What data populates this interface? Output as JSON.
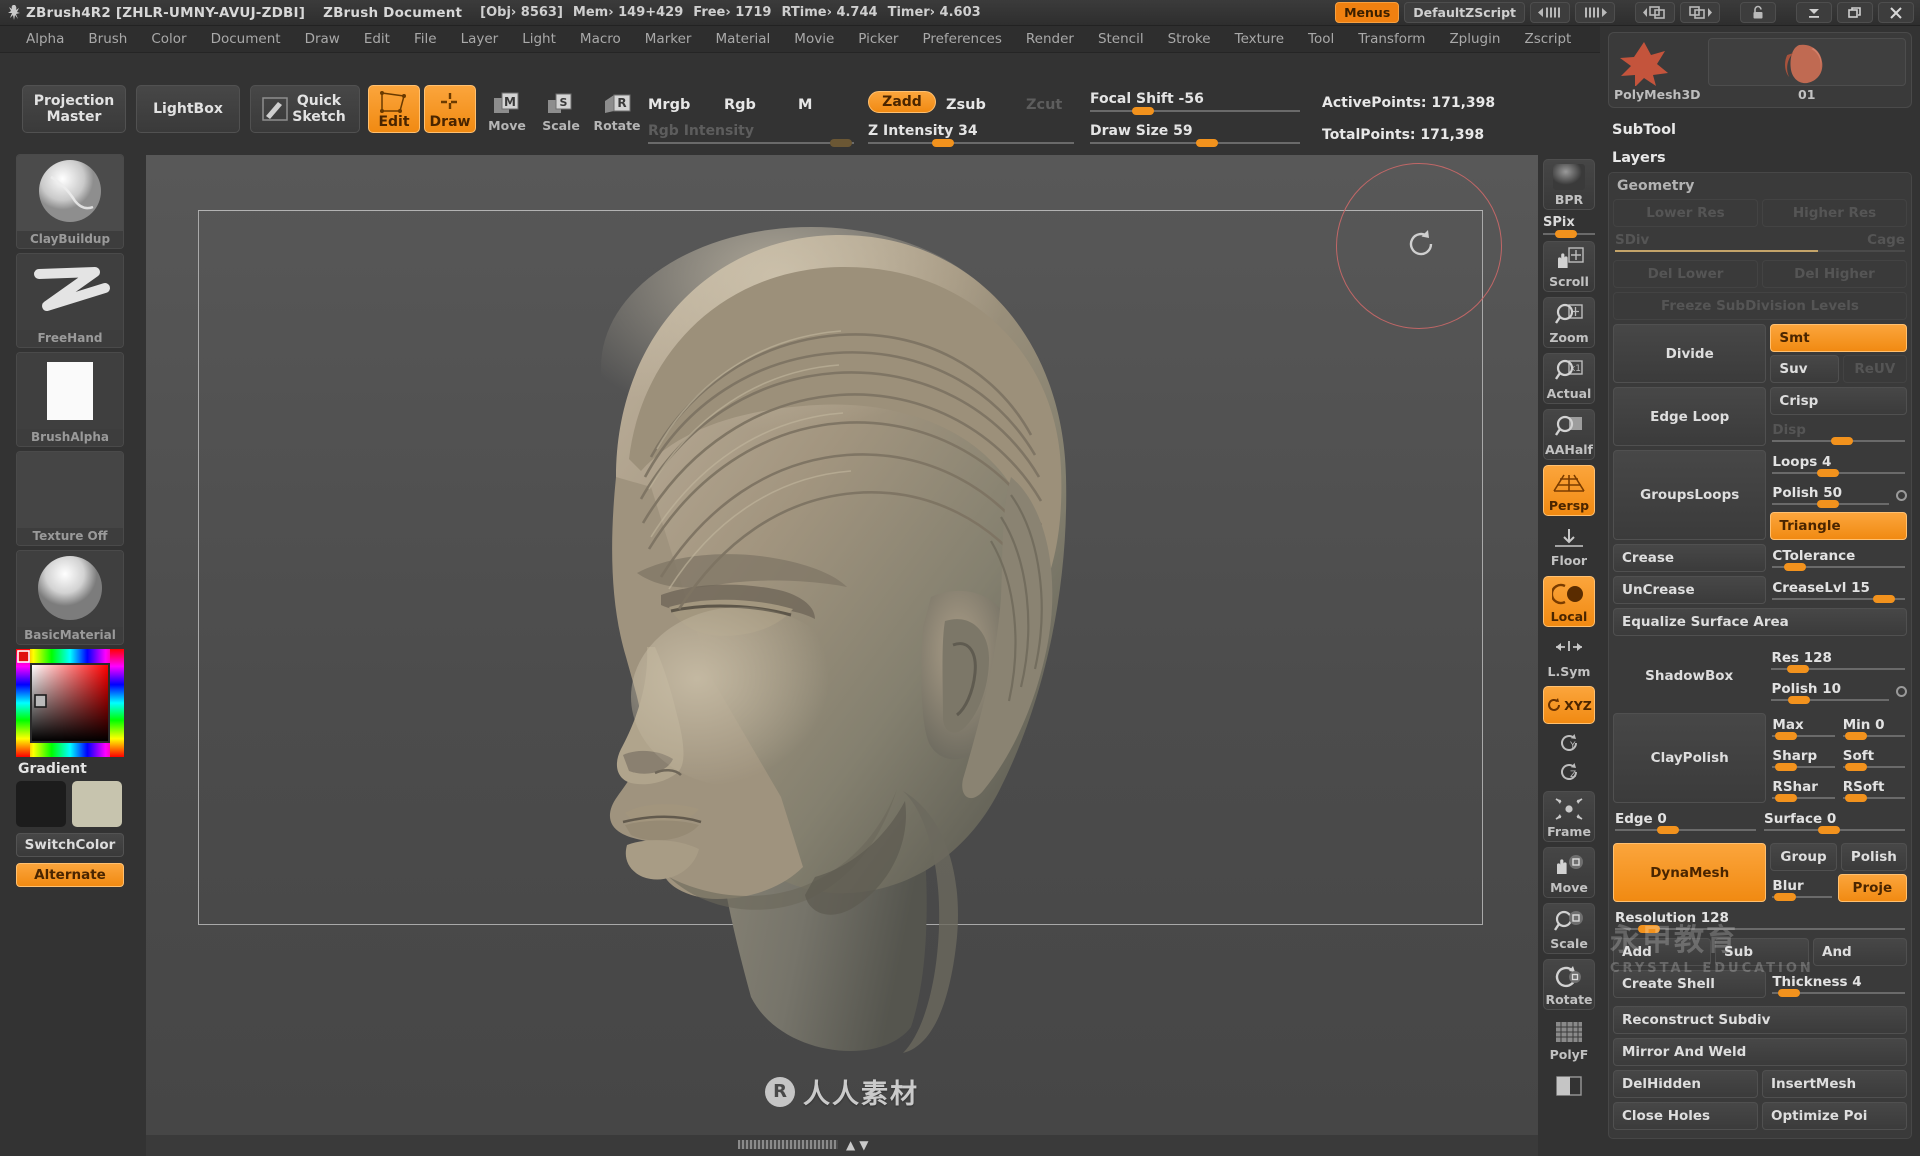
{
  "titlebar": {
    "app_title": "ZBrush4R2 [ZHLR-UMNY-AVUJ-ZDBI]",
    "document_title": "ZBrush Document",
    "stats": [
      "[Obj› 8563]",
      "Mem› 149+429",
      "Free› 1719",
      "RTime› 4.744",
      "Timer› 4.603"
    ],
    "menus_label": "Menus",
    "zscript_label": "DefaultZScript",
    "icons": [
      "prev-page-icon",
      "next-page-icon",
      "prev-window-icon",
      "next-window-icon",
      "lock-icon",
      "minimize-icon",
      "restore-icon",
      "close-icon"
    ]
  },
  "menubar": {
    "items": [
      "Alpha",
      "Brush",
      "Color",
      "Document",
      "Draw",
      "Edit",
      "File",
      "Layer",
      "Light",
      "Macro",
      "Marker",
      "Material",
      "Movie",
      "Picker",
      "Preferences",
      "Render",
      "Stencil",
      "Stroke",
      "Texture",
      "Tool",
      "Transform",
      "Zplugin",
      "Zscript"
    ]
  },
  "toolbar": {
    "projection_master": "Projection\nMaster",
    "lightbox": "LightBox",
    "quick_sketch": "Quick\nSketch",
    "edit": "Edit",
    "draw": "Draw",
    "move": "Move",
    "scale": "Scale",
    "rotate": "Rotate",
    "mrgb": "Mrgb",
    "rgb": "Rgb",
    "m": "M",
    "zadd": "Zadd",
    "zsub": "Zsub",
    "zcut": "Zcut",
    "rgb_intensity": "Rgb Intensity",
    "z_intensity": "Z Intensity 34",
    "focal_shift": "Focal Shift -56",
    "draw_size": "Draw Size 59",
    "active_points": "ActivePoints: 171,398",
    "total_points": "TotalPoints: 171,398"
  },
  "left_palette": {
    "slots": [
      {
        "name": "ClayBuildup",
        "kind": "brush"
      },
      {
        "name": "FreeHand",
        "kind": "stroke"
      },
      {
        "name": "BrushAlpha",
        "kind": "alpha"
      },
      {
        "name": "Texture Off",
        "kind": "texture"
      },
      {
        "name": "BasicMaterial",
        "kind": "material"
      }
    ],
    "gradient_label": "Gradient",
    "switch_color": "SwitchColor",
    "alternate": "Alternate",
    "main_color": "#1c1c1c",
    "secondary_color": "#c7c4ae"
  },
  "right_toolbar": {
    "items": [
      {
        "label": "BPR",
        "icon": "bpr-render-icon",
        "active": false,
        "type": "button"
      },
      {
        "label": "SPix",
        "icon": "spix-slider",
        "value": 50,
        "type": "slider"
      },
      {
        "label": "Scroll",
        "icon": "hand-scroll-icon",
        "active": false,
        "type": "button"
      },
      {
        "label": "Zoom",
        "icon": "magnifier-zoom-icon",
        "active": false,
        "type": "button"
      },
      {
        "label": "Actual",
        "icon": "magnifier-actual-icon",
        "active": false,
        "type": "button"
      },
      {
        "label": "AAHalf",
        "icon": "magnifier-aahalf-icon",
        "active": false,
        "type": "button"
      },
      {
        "label": "Persp",
        "icon": "perspective-grid-icon",
        "active": true,
        "type": "button"
      },
      {
        "label": "Floor",
        "icon": "floor-grid-icon",
        "active": false,
        "type": "flat"
      },
      {
        "label": "Local",
        "icon": "local-symmetry-icon",
        "active": true,
        "type": "button"
      },
      {
        "label": "L.Sym",
        "icon": "local-sym-arrows-icon",
        "active": false,
        "type": "flat"
      },
      {
        "label": "XYZ",
        "icon": "xyz-rotate-icon",
        "active": true,
        "type": "button"
      },
      {
        "label": "Y",
        "icon": "rotate-y-icon",
        "active": false,
        "type": "flat"
      },
      {
        "label": "Z",
        "icon": "rotate-z-icon",
        "active": false,
        "type": "flat"
      },
      {
        "label": "Frame",
        "icon": "frame-fit-icon",
        "active": false,
        "type": "button"
      },
      {
        "label": "Move",
        "icon": "hand-move-icon",
        "active": false,
        "type": "button"
      },
      {
        "label": "Scale",
        "icon": "magnifier-scale-icon",
        "active": false,
        "type": "button"
      },
      {
        "label": "Rotate",
        "icon": "rotate-gizmo-icon",
        "active": false,
        "type": "button"
      },
      {
        "label": "PolyF",
        "icon": "polyframe-grid-icon",
        "active": false,
        "type": "flat"
      },
      {
        "label": "",
        "icon": "transp-icon",
        "active": false,
        "type": "flat"
      }
    ]
  },
  "right_panel": {
    "tool_name": "PolyMesh3D",
    "subtool_name": "01",
    "subtool_title": "SubTool",
    "layers_title": "Layers",
    "geometry": {
      "title": "Geometry",
      "lower_res": "Lower Res",
      "higher_res": "Higher Res",
      "sdiv": "SDiv",
      "cage": "Cage",
      "del_lower": "Del Lower",
      "del_higher": "Del Higher",
      "freeze": "Freeze SubDivision Levels",
      "divide": "Divide",
      "smt": "Smt",
      "suv": "Suv",
      "reuv": "ReUV",
      "edge_loop": "Edge Loop",
      "crisp": "Crisp",
      "disp": "Disp",
      "groups_loops": "GroupsLoops",
      "loops": "Loops 4",
      "polish_loops": "Polish 50",
      "triangle": "Triangle",
      "crease": "Crease",
      "ctolerance": "CTolerance",
      "uncrease": "UnCrease",
      "creaselvl": "CreaseLvl 15",
      "equalize": "Equalize Surface Area",
      "shadowbox": "ShadowBox",
      "res": "Res 128",
      "polish_sb": "Polish 10",
      "claypolish": "ClayPolish",
      "max": "Max",
      "min": "Min 0",
      "sharp": "Sharp",
      "soft": "Soft",
      "rshar": "RShar",
      "rsoft": "RSoft",
      "edge": "Edge 0",
      "surface": "Surface 0",
      "dynamesh": "DynaMesh",
      "group": "Group",
      "polish_dm": "Polish",
      "blur": "Blur",
      "project": "Proje",
      "resolution": "Resolution 128",
      "add": "Add",
      "sub": "Sub",
      "and": "And",
      "create_shell": "Create Shell",
      "thickness": "Thickness 4",
      "reconstruct": "Reconstruct Subdiv",
      "mirror_weld": "Mirror And Weld",
      "del_hidden": "DelHidden",
      "insert_mesh": "InsertMesh",
      "close_holes": "Close Holes",
      "optimize": "Optimize Poi"
    }
  },
  "watermark": {
    "canvas_text": "人人素材",
    "panel_text": "永甲教育",
    "panel_sub": "CRYSTAL EDUCATION"
  },
  "accent_color": "#f2921d"
}
